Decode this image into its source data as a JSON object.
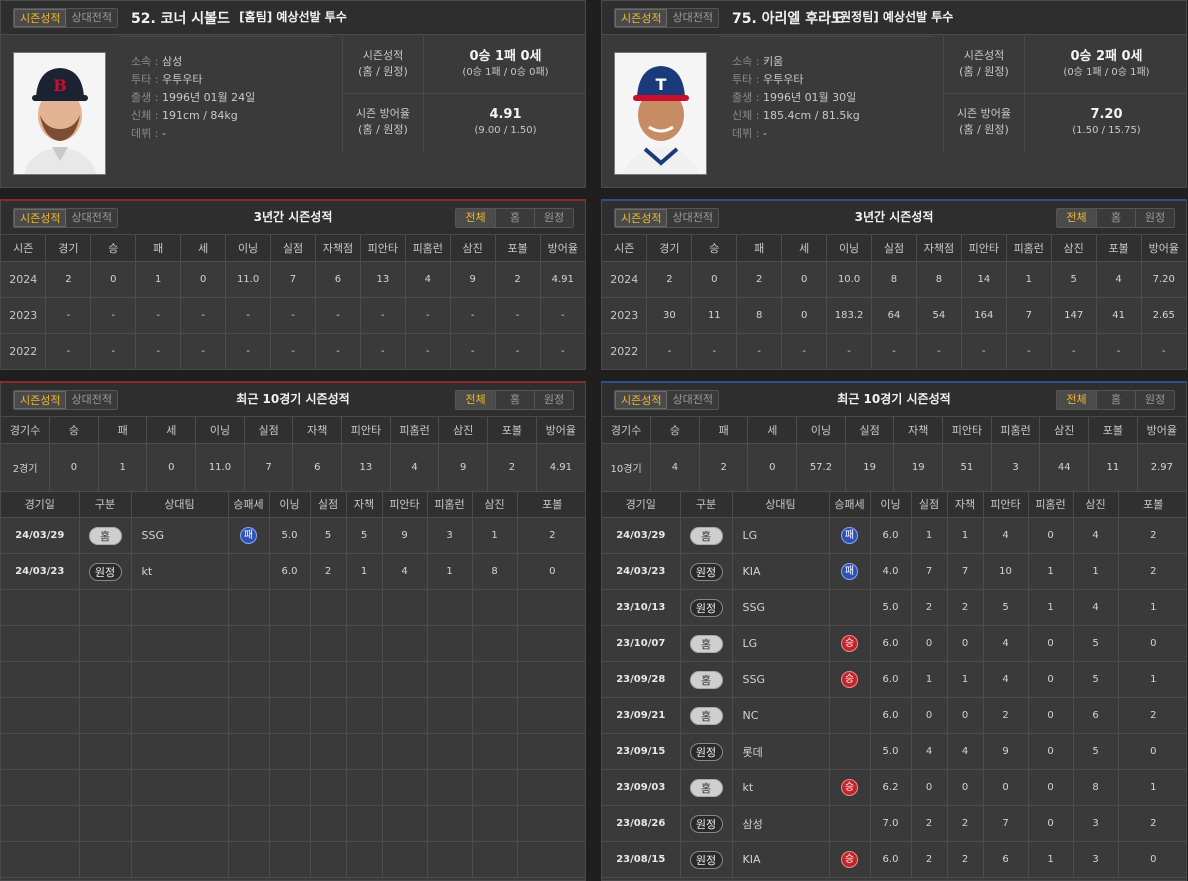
{
  "tabs": {
    "season": "시즌성적",
    "vs": "상대전적"
  },
  "filters": {
    "all": "전체",
    "home": "홈",
    "away": "원정"
  },
  "left": {
    "header": "[홈팀] 예상선발 투수",
    "name": "52. 코너 시볼드",
    "info": [
      {
        "k": "소속",
        "v": "삼성"
      },
      {
        "k": "투타",
        "v": "우투우타"
      },
      {
        "k": "출생",
        "v": "1996년 01월 24일"
      },
      {
        "k": "신체",
        "v": "191cm / 84kg"
      },
      {
        "k": "데뷔",
        "v": "-"
      }
    ],
    "record_label": [
      "시즌성적",
      "(홈 / 원정)"
    ],
    "record_big": "0승 1패 0세",
    "record_small": "(0승 1패 / 0승 0패)",
    "era_label": [
      "시즌 방어율",
      "(홈 / 원정)"
    ],
    "era_big": "4.91",
    "era_small": "(9.00 / 1.50)",
    "three_year_title": "3년간 시즌성적",
    "three_year": [
      [
        "2024",
        "2",
        "0",
        "1",
        "0",
        "11.0",
        "7",
        "6",
        "13",
        "4",
        "9",
        "2",
        "4.91"
      ],
      [
        "2023",
        "-",
        "-",
        "-",
        "-",
        "-",
        "-",
        "-",
        "-",
        "-",
        "-",
        "-",
        "-"
      ],
      [
        "2022",
        "-",
        "-",
        "-",
        "-",
        "-",
        "-",
        "-",
        "-",
        "-",
        "-",
        "-",
        "-"
      ]
    ],
    "recent_title": "최근 10경기 시즌성적",
    "recent_summary": [
      "2경기",
      "0",
      "1",
      "0",
      "11.0",
      "7",
      "6",
      "13",
      "4",
      "9",
      "2",
      "4.91"
    ],
    "games": [
      {
        "date": "24/03/29",
        "type": "홈",
        "opp": "SSG",
        "res": "패",
        "ip": "5.0",
        "r": "5",
        "er": "5",
        "h": "9",
        "hr": "3",
        "so": "1",
        "bb": "2"
      },
      {
        "date": "24/03/23",
        "type": "원정",
        "opp": "kt",
        "res": "",
        "ip": "6.0",
        "r": "2",
        "er": "1",
        "h": "4",
        "hr": "1",
        "so": "8",
        "bb": "0"
      }
    ]
  },
  "right": {
    "header": "[원정팀] 예상선발 투수",
    "name": "75. 아리엘 후라도",
    "info": [
      {
        "k": "소속",
        "v": "키움"
      },
      {
        "k": "투타",
        "v": "우투우타"
      },
      {
        "k": "출생",
        "v": "1996년 01월 30일"
      },
      {
        "k": "신체",
        "v": "185.4cm / 81.5kg"
      },
      {
        "k": "데뷔",
        "v": "-"
      }
    ],
    "record_label": [
      "시즌성적",
      "(홈 / 원정)"
    ],
    "record_big": "0승 2패 0세",
    "record_small": "(0승 1패 / 0승 1패)",
    "era_label": [
      "시즌 방어율",
      "(홈 / 원정)"
    ],
    "era_big": "7.20",
    "era_small": "(1.50 / 15.75)",
    "three_year_title": "3년간 시즌성적",
    "three_year": [
      [
        "2024",
        "2",
        "0",
        "2",
        "0",
        "10.0",
        "8",
        "8",
        "14",
        "1",
        "5",
        "4",
        "7.20"
      ],
      [
        "2023",
        "30",
        "11",
        "8",
        "0",
        "183.2",
        "64",
        "54",
        "164",
        "7",
        "147",
        "41",
        "2.65"
      ],
      [
        "2022",
        "-",
        "-",
        "-",
        "-",
        "-",
        "-",
        "-",
        "-",
        "-",
        "-",
        "-",
        "-"
      ]
    ],
    "recent_title": "최근 10경기 시즌성적",
    "recent_summary": [
      "10경기",
      "4",
      "2",
      "0",
      "57.2",
      "19",
      "19",
      "51",
      "3",
      "44",
      "11",
      "2.97"
    ],
    "games": [
      {
        "date": "24/03/29",
        "type": "홈",
        "opp": "LG",
        "res": "패",
        "ip": "6.0",
        "r": "1",
        "er": "1",
        "h": "4",
        "hr": "0",
        "so": "4",
        "bb": "2"
      },
      {
        "date": "24/03/23",
        "type": "원정",
        "opp": "KIA",
        "res": "패",
        "ip": "4.0",
        "r": "7",
        "er": "7",
        "h": "10",
        "hr": "1",
        "so": "1",
        "bb": "2"
      },
      {
        "date": "23/10/13",
        "type": "원정",
        "opp": "SSG",
        "res": "",
        "ip": "5.0",
        "r": "2",
        "er": "2",
        "h": "5",
        "hr": "1",
        "so": "4",
        "bb": "1"
      },
      {
        "date": "23/10/07",
        "type": "홈",
        "opp": "LG",
        "res": "승",
        "ip": "6.0",
        "r": "0",
        "er": "0",
        "h": "4",
        "hr": "0",
        "so": "5",
        "bb": "0"
      },
      {
        "date": "23/09/28",
        "type": "홈",
        "opp": "SSG",
        "res": "승",
        "ip": "6.0",
        "r": "1",
        "er": "1",
        "h": "4",
        "hr": "0",
        "so": "5",
        "bb": "1"
      },
      {
        "date": "23/09/21",
        "type": "홈",
        "opp": "NC",
        "res": "",
        "ip": "6.0",
        "r": "0",
        "er": "0",
        "h": "2",
        "hr": "0",
        "so": "6",
        "bb": "2"
      },
      {
        "date": "23/09/15",
        "type": "원정",
        "opp": "롯데",
        "res": "",
        "ip": "5.0",
        "r": "4",
        "er": "4",
        "h": "9",
        "hr": "0",
        "so": "5",
        "bb": "0"
      },
      {
        "date": "23/09/03",
        "type": "홈",
        "opp": "kt",
        "res": "승",
        "ip": "6.2",
        "r": "0",
        "er": "0",
        "h": "0",
        "hr": "0",
        "so": "8",
        "bb": "1"
      },
      {
        "date": "23/08/26",
        "type": "원정",
        "opp": "삼성",
        "res": "",
        "ip": "7.0",
        "r": "2",
        "er": "2",
        "h": "7",
        "hr": "0",
        "so": "3",
        "bb": "2"
      },
      {
        "date": "23/08/15",
        "type": "원정",
        "opp": "KIA",
        "res": "승",
        "ip": "6.0",
        "r": "2",
        "er": "2",
        "h": "6",
        "hr": "1",
        "so": "3",
        "bb": "0"
      }
    ]
  },
  "season_cols": [
    "시즌",
    "경기",
    "승",
    "패",
    "세",
    "이닝",
    "실점",
    "자책점",
    "피안타",
    "피홈런",
    "삼진",
    "포볼",
    "방어율"
  ],
  "recent_cols": [
    "경기수",
    "승",
    "패",
    "세",
    "이닝",
    "실점",
    "자책",
    "피안타",
    "피홈런",
    "삼진",
    "포볼",
    "방어율"
  ],
  "game_cols": [
    "경기일",
    "구분",
    "상대팀",
    "승패세",
    "이닝",
    "실점",
    "자책",
    "피안타",
    "피홈런",
    "삼진",
    "포볼"
  ],
  "colors": {
    "active_tab": "#f0b92c",
    "home_accent": "#8b2a2a",
    "away_accent": "#2f4f8a",
    "win": "#c0262b",
    "loss": "#2c52b8"
  }
}
